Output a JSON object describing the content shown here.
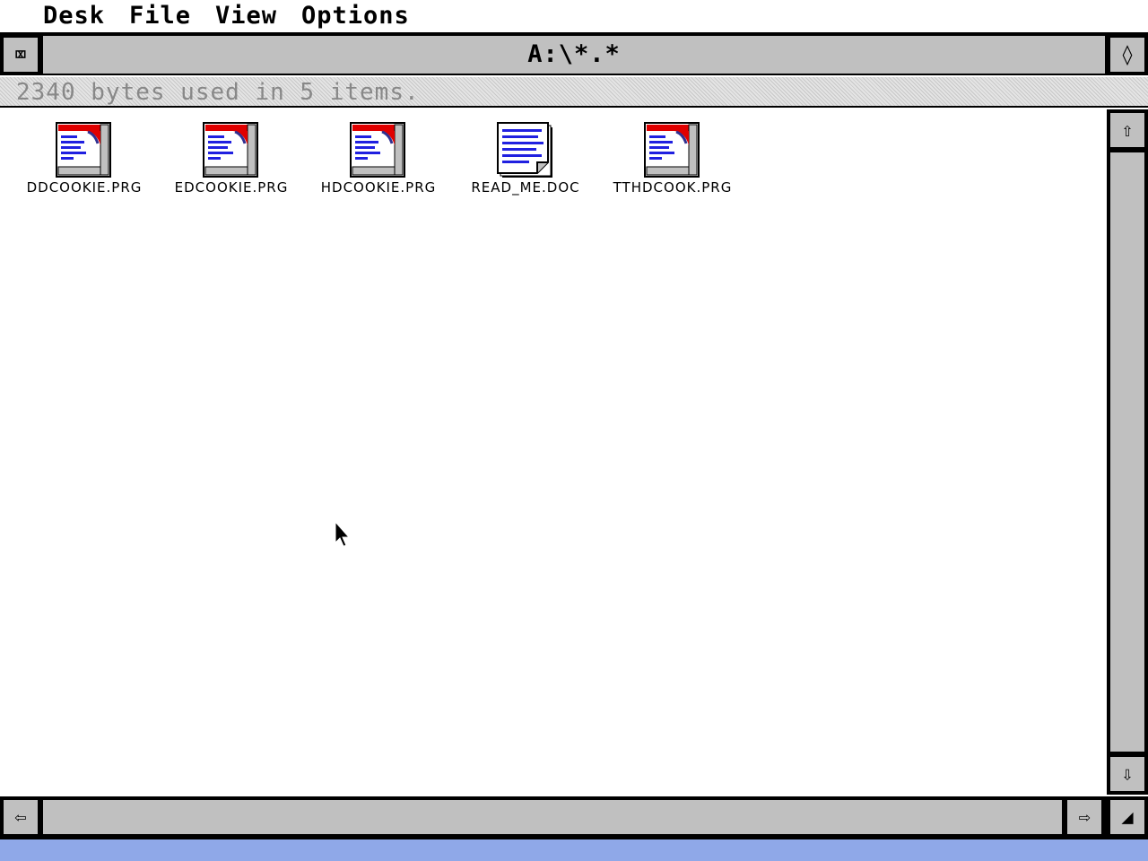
{
  "menubar": {
    "items": [
      {
        "label": "Desk"
      },
      {
        "label": "File"
      },
      {
        "label": "View"
      },
      {
        "label": "Options"
      }
    ]
  },
  "window": {
    "title": "A:\\*.*",
    "info_line": "2340 bytes used in 5 items.",
    "controls": {
      "closer_glyph": "⌧",
      "fuller_glyph": "◊",
      "up_glyph": "⇧",
      "down_glyph": "⇩",
      "left_glyph": "⇦",
      "right_glyph": "⇨",
      "sizer_glyph": "◢"
    }
  },
  "files": [
    {
      "name": "DDCOOKIE.PRG",
      "icon": "program-icon"
    },
    {
      "name": "EDCOOKIE.PRG",
      "icon": "program-icon"
    },
    {
      "name": "HDCOOKIE.PRG",
      "icon": "program-icon"
    },
    {
      "name": "READ_ME.DOC",
      "icon": "document-icon"
    },
    {
      "name": "TTHDCOOK.PRG",
      "icon": "program-icon"
    }
  ],
  "colors": {
    "desktop": "#8fa8e8",
    "chrome": "#c0c0c0",
    "icon_text_lines": "#2020e0",
    "icon_accent": "#e00000"
  }
}
